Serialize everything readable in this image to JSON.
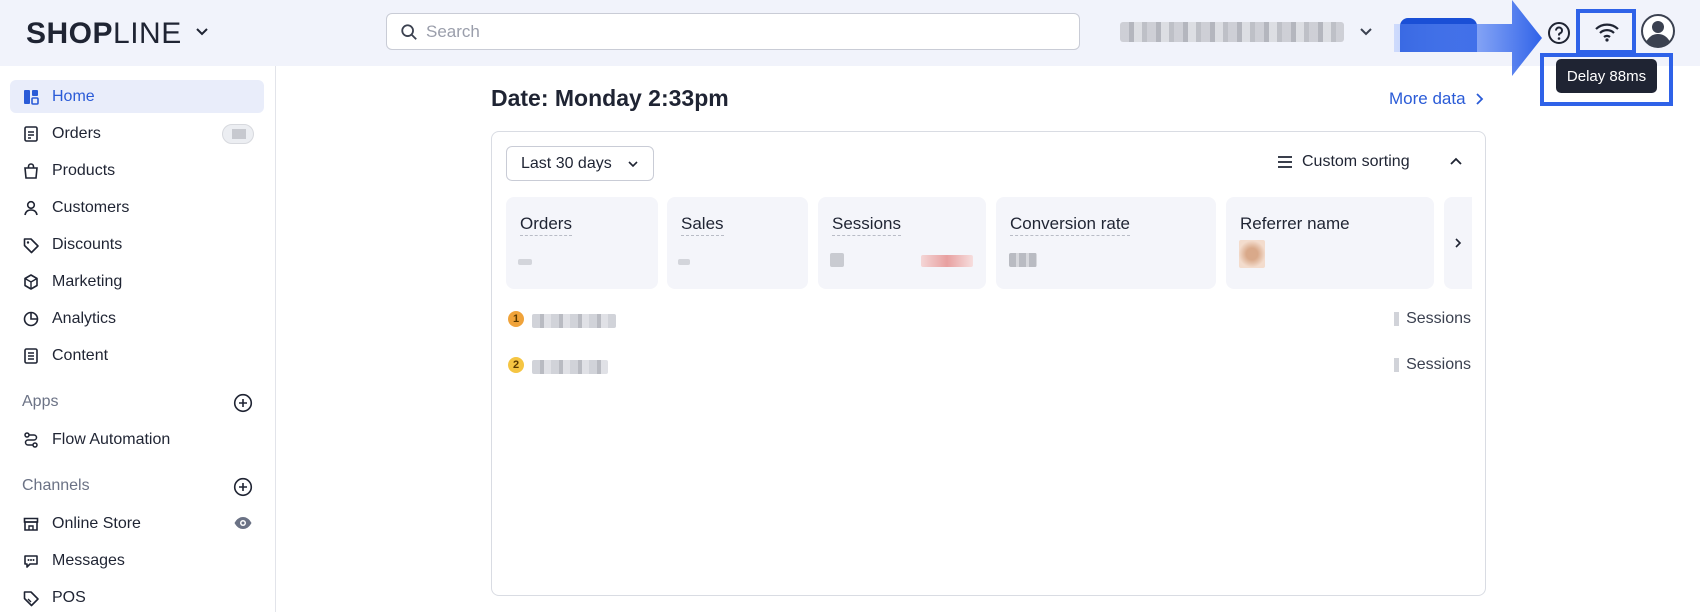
{
  "header": {
    "logo_bold": "SHOP",
    "logo_light": "LINE",
    "search_placeholder": "Search",
    "tooltip": "Delay 88ms"
  },
  "sidebar": {
    "items": [
      {
        "label": "Home",
        "icon": "home-icon",
        "active": true
      },
      {
        "label": "Orders",
        "icon": "orders-icon"
      },
      {
        "label": "Products",
        "icon": "bag-icon"
      },
      {
        "label": "Customers",
        "icon": "person-icon"
      },
      {
        "label": "Discounts",
        "icon": "tag-icon"
      },
      {
        "label": "Marketing",
        "icon": "cube-icon"
      },
      {
        "label": "Analytics",
        "icon": "pie-chart-icon"
      },
      {
        "label": "Content",
        "icon": "document-icon"
      }
    ],
    "apps_title": "Apps",
    "apps": [
      {
        "label": "Flow Automation",
        "icon": "flow-icon"
      }
    ],
    "channels_title": "Channels",
    "channels": [
      {
        "label": "Online Store",
        "icon": "store-icon"
      },
      {
        "label": "Messages",
        "icon": "chat-icon"
      },
      {
        "label": "POS",
        "icon": "pos-tag-icon"
      }
    ]
  },
  "main": {
    "date_title": "Date: Monday 2:33pm",
    "more_data": "More data",
    "range_label": "Last 30 days",
    "sort_label": "Custom sorting",
    "cards": [
      "Orders",
      "Sales",
      "Sessions",
      "Conversion rate",
      "Referrer name"
    ],
    "ranking": [
      {
        "rank": "1",
        "sessions_label": "Sessions",
        "color": "#f0a33a"
      },
      {
        "rank": "2",
        "sessions_label": "Sessions",
        "color": "#f5c542"
      }
    ]
  },
  "colors": {
    "accent": "#2a5bd7",
    "highlight": "#2f62e8",
    "topbar_bg": "#f1f3fb"
  }
}
